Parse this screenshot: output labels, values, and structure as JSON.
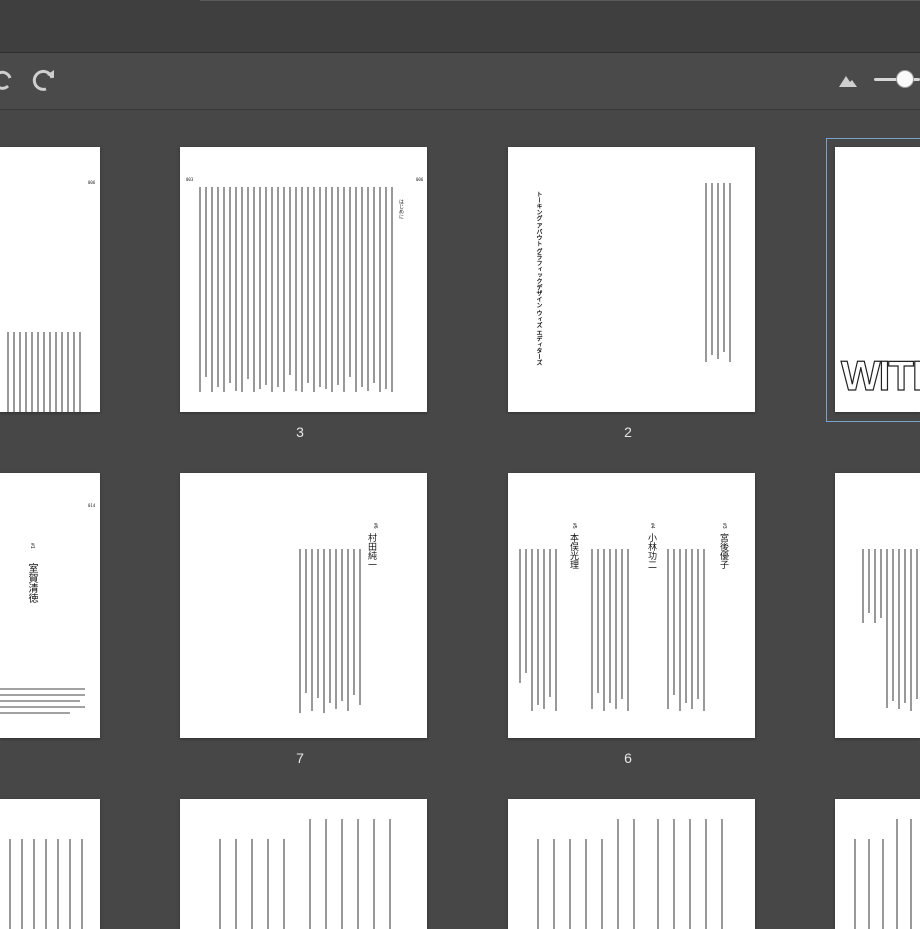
{
  "pages": {
    "p2_number": "2",
    "p3_number": "3",
    "p6_number": "6",
    "p7_number": "7",
    "p2_title": "トーキング アバウト グラフィックデザイン ウィズ エディターズ",
    "p3_heading": "はじめに",
    "with_text": "WITH",
    "p6_entries": [
      {
        "num": "#3",
        "name": "宮後優子"
      },
      {
        "num": "#4",
        "name": "小林功二"
      },
      {
        "num": "#5",
        "name": "本俣光理"
      }
    ],
    "p7_entry": {
      "num": "#6",
      "name": "村田純一"
    },
    "p8_entry": {
      "num": "#1",
      "name": "室賀清徳"
    },
    "folios": {
      "left_top": "006",
      "p3_left": "003",
      "p3_right": "006",
      "row2_left": "014"
    }
  },
  "colors": {
    "background": "#474747",
    "toolbar": "#4a4a4a",
    "page": "#ffffff",
    "selection": "#7aa2c8"
  },
  "icons": [
    "undo-icon",
    "redo-icon",
    "mountain-small-icon",
    "zoom-slider"
  ]
}
